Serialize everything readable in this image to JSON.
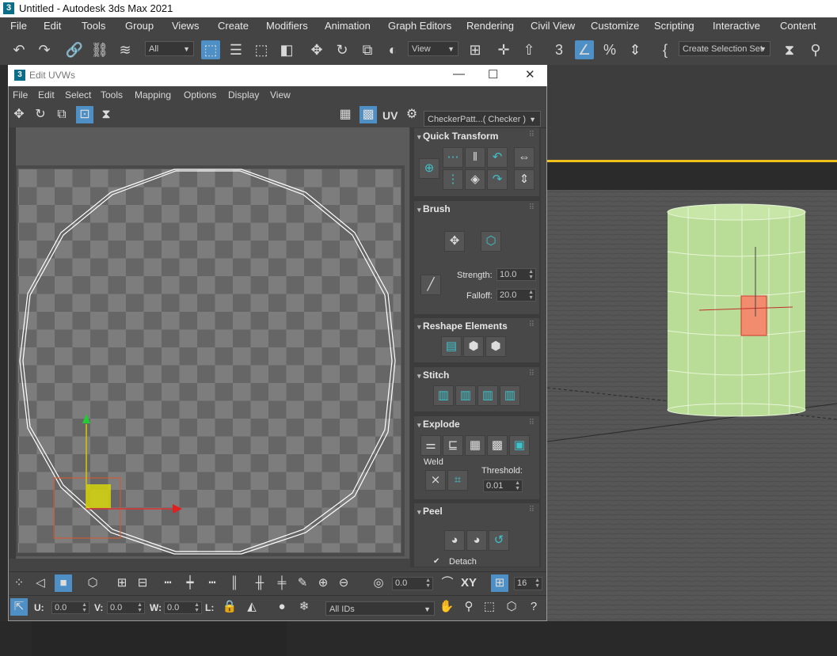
{
  "app": {
    "title": "Untitled - Autodesk 3ds Max 2021",
    "logo": "3"
  },
  "main_menu": [
    "File",
    "Edit",
    "Tools",
    "Group",
    "Views",
    "Create",
    "Modifiers",
    "Animation",
    "Graph Editors",
    "Rendering",
    "Civil View",
    "Customize",
    "Scripting",
    "Interactive",
    "Content"
  ],
  "main_toolbar": {
    "selection_filter": "All",
    "ref_coord": "View",
    "named_selection": "Create Selection Set"
  },
  "uvw_window": {
    "title": "Edit UVWs",
    "logo": "3",
    "menu": [
      "File",
      "Edit",
      "Select",
      "Tools",
      "Mapping",
      "Options",
      "Display",
      "View"
    ],
    "uv_label": "UV",
    "checker": "CheckerPatt...( Checker )"
  },
  "rollouts": {
    "quick_transform": {
      "title": "Quick Transform"
    },
    "brush": {
      "title": "Brush",
      "strength_label": "Strength:",
      "strength": "10.0",
      "falloff_label": "Falloff:",
      "falloff": "20.0"
    },
    "reshape": {
      "title": "Reshape Elements"
    },
    "stitch": {
      "title": "Stitch"
    },
    "explode": {
      "title": "Explode",
      "weld_label": "Weld",
      "threshold_label": "Threshold:",
      "threshold": "0.01"
    },
    "peel": {
      "title": "Peel",
      "detach_label": "Detach"
    }
  },
  "uv_bottom": {
    "angle_value": "0.0",
    "xy_label": "XY",
    "grid_value": "16",
    "u_label": "U:",
    "u_value": "0.0",
    "v_label": "V:",
    "v_value": "0.0",
    "w_label": "W:",
    "w_value": "0.0",
    "l_label": "L:",
    "id_filter": "All IDs"
  },
  "colors": {
    "accent": "#4e8fc5",
    "teal": "#3fc1c9",
    "selection_yellow": "#d4d40a",
    "cylinder": "#b9dc97",
    "selected_face": "#f28c6e"
  }
}
